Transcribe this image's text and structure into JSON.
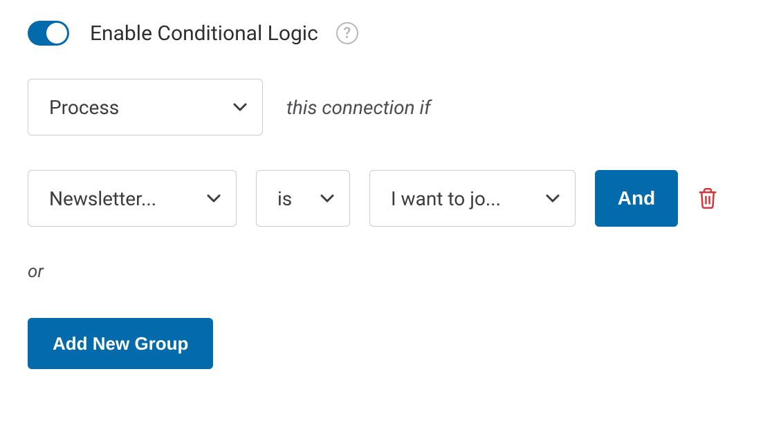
{
  "header": {
    "label": "Enable Conditional Logic",
    "help_glyph": "?"
  },
  "process": {
    "select_label": "Process",
    "hint": "this connection if"
  },
  "rule": {
    "field": "Newsletter...",
    "operator": "is",
    "value": "I want to jo...",
    "and_button": "And"
  },
  "or_label": "or",
  "add_group_button": "Add New Group",
  "colors": {
    "blue": "#036aab",
    "red": "#d63638"
  },
  "icons": {
    "toggle": "toggle-on",
    "help": "help-circle",
    "chevron": "chevron-down",
    "trash": "trash"
  }
}
